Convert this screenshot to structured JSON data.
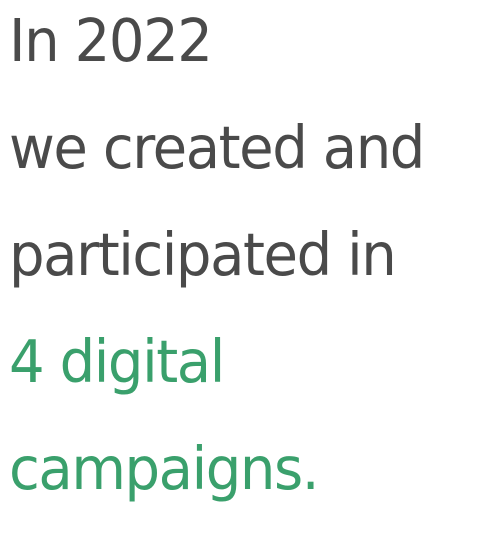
{
  "statement": {
    "lines": [
      {
        "text": "In 2022",
        "color": "#4a4a4a"
      },
      {
        "text": "we created and",
        "color": "#4a4a4a"
      },
      {
        "text": "participated in",
        "color": "#4a4a4a"
      },
      {
        "text": "4 digital",
        "color": "#3aa06c"
      },
      {
        "text": "campaigns.",
        "color": "#3aa06c"
      }
    ]
  }
}
